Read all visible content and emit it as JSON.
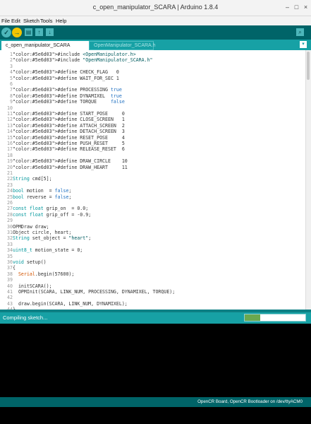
{
  "window": {
    "title": "c_open_manipulator_SCARA | Arduino 1.8.4"
  },
  "menu": [
    "File",
    "Edit",
    "Sketch",
    "Tools",
    "Help"
  ],
  "toolbar": {
    "verify": "✓",
    "upload": "→",
    "new": "▤",
    "open": "↑",
    "save": "↓",
    "monitor": "⌕"
  },
  "tabs": [
    {
      "label": "c_open_manipulator_SCARA",
      "active": true
    },
    {
      "label": "OpenManipulator_SCARA.h",
      "active": false
    }
  ],
  "tab_menu_icon": "▾",
  "code_lines": [
    {
      "n": "1",
      "t": "#include <OpenManipulator.h>"
    },
    {
      "n": "2",
      "t": "#include \"OpenManipulator_SCARA.h\""
    },
    {
      "n": "3",
      "t": ""
    },
    {
      "n": "4",
      "t": "#define CHECK_FLAG   0"
    },
    {
      "n": "5",
      "t": "#define WAIT_FOR_SEC 1"
    },
    {
      "n": "6",
      "t": ""
    },
    {
      "n": "7",
      "t": "#define PROCESSING true"
    },
    {
      "n": "8",
      "t": "#define DYNAMIXEL  true"
    },
    {
      "n": "9",
      "t": "#define TORQUE     false"
    },
    {
      "n": "10",
      "t": ""
    },
    {
      "n": "11",
      "t": "#define START_POSE     0"
    },
    {
      "n": "12",
      "t": "#define CLOSE_SCREEN   1"
    },
    {
      "n": "13",
      "t": "#define ATTACH_SCREEN  2"
    },
    {
      "n": "14",
      "t": "#define DETACH_SCREEN  3"
    },
    {
      "n": "15",
      "t": "#define RESET_POSE     4"
    },
    {
      "n": "16",
      "t": "#define PUSH_RESET     5"
    },
    {
      "n": "17",
      "t": "#define RELEASE_RESET  6"
    },
    {
      "n": "18",
      "t": ""
    },
    {
      "n": "19",
      "t": "#define DRAW_CIRCLE    10"
    },
    {
      "n": "20",
      "t": "#define DRAW_HEART     11"
    },
    {
      "n": "21",
      "t": ""
    },
    {
      "n": "22",
      "t": "String cmd[5];"
    },
    {
      "n": "23",
      "t": ""
    },
    {
      "n": "24",
      "t": "bool motion  = false;"
    },
    {
      "n": "25",
      "t": "bool reverse = false;"
    },
    {
      "n": "26",
      "t": ""
    },
    {
      "n": "27",
      "t": "const float grip_on  = 0.0;"
    },
    {
      "n": "28",
      "t": "const float grip_off = -0.9;"
    },
    {
      "n": "29",
      "t": ""
    },
    {
      "n": "30",
      "t": "OPMDraw draw;"
    },
    {
      "n": "31",
      "t": "Object circle, heart;"
    },
    {
      "n": "32",
      "t": "String set_object = \"heart\";"
    },
    {
      "n": "33",
      "t": ""
    },
    {
      "n": "34",
      "t": "uint8_t motion_state = 0;"
    },
    {
      "n": "35",
      "t": ""
    },
    {
      "n": "36",
      "t": "void setup()"
    },
    {
      "n": "37",
      "t": "{"
    },
    {
      "n": "38",
      "t": "  Serial.begin(57600);"
    },
    {
      "n": "39",
      "t": ""
    },
    {
      "n": "40",
      "t": "  initSCARA();"
    },
    {
      "n": "41",
      "t": "  OPMInit(SCARA, LINK_NUM, PROCESSING, DYNAMIXEL, TORQUE);"
    },
    {
      "n": "42",
      "t": ""
    },
    {
      "n": "43",
      "t": "  draw.begin(SCARA, LINK_NUM, DYNAMIXEL);"
    },
    {
      "n": "44",
      "t": "}"
    }
  ],
  "status": {
    "message": "Compiling sketch...",
    "progress": 0.25
  },
  "board_info": "OpenCR Board, OpenCR Bootloader on /dev/ttyACM0",
  "colors": {
    "toolbar": "#006468",
    "tabbar": "#17a1a5",
    "keyword": "#5e6d03",
    "type": "#00979c",
    "literal": "#1f6fc0",
    "string": "#005c5f",
    "function": "#d35400"
  }
}
